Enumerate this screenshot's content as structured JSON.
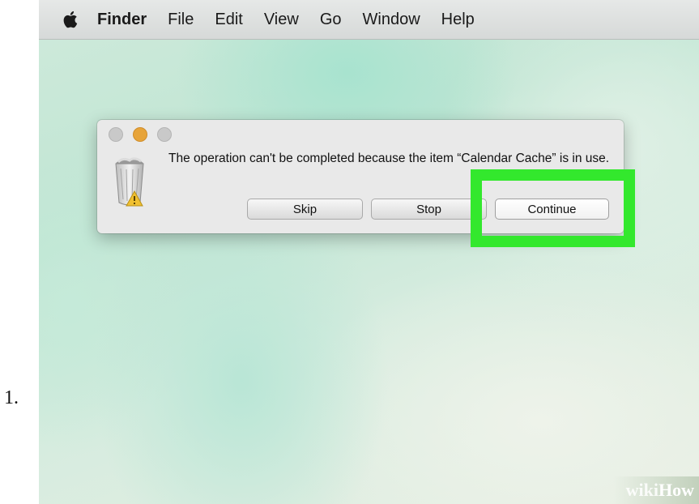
{
  "step": {
    "number": "1."
  },
  "menubar": {
    "apple_icon": "apple-logo-icon",
    "app_name": "Finder",
    "items": [
      "File",
      "Edit",
      "View",
      "Go",
      "Window",
      "Help"
    ]
  },
  "dialog": {
    "window_buttons": [
      "close",
      "minimize",
      "zoom"
    ],
    "icon": "trash-warning-icon",
    "message": "The operation can't be completed because the item “Calendar Cache” is in use.",
    "buttons": {
      "skip": "Skip",
      "stop": "Stop",
      "continue": "Continue"
    }
  },
  "highlight": {
    "color": "#33e82d",
    "target": "continue"
  },
  "watermark": {
    "part1": "wiki",
    "part2": "How"
  },
  "colors": {
    "minimize_button": "#e7a43a",
    "highlight": "#33e82d"
  }
}
